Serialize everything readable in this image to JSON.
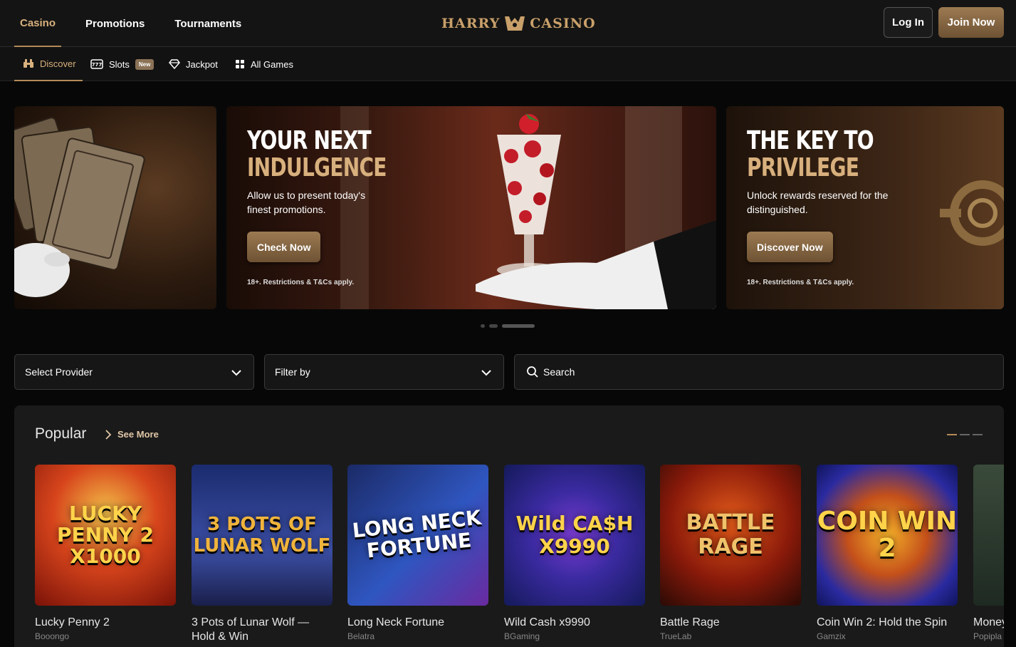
{
  "topnav": {
    "items": [
      "Casino",
      "Promotions",
      "Tournaments"
    ],
    "active": "Casino"
  },
  "logo": {
    "left": "HARRY",
    "right": "CASINO"
  },
  "auth": {
    "login": "Log In",
    "join": "Join Now"
  },
  "subnav": {
    "tabs": [
      {
        "label": "Discover",
        "icon": "binoculars-icon"
      },
      {
        "label": "Slots",
        "icon": "slot-machine-icon",
        "badge": "New"
      },
      {
        "label": "Jackpot",
        "icon": "diamond-icon"
      },
      {
        "label": "All Games",
        "icon": "grid-icon"
      }
    ]
  },
  "banners": [
    {
      "title1": "YOUR NEXT",
      "title2": "INDULGENCE",
      "desc": "Allow us to present today's finest promotions.",
      "cta": "Check Now",
      "terms": "18+. Restrictions & T&Cs apply."
    },
    {
      "title1": "THE KEY TO",
      "title2": "PRIVILEGE",
      "desc": "Unlock rewards reserved for the distinguished.",
      "cta": "Discover Now",
      "terms": "18+. Restrictions & T&Cs apply."
    }
  ],
  "filters": {
    "provider": "Select Provider",
    "filter": "Filter by",
    "search": "Search"
  },
  "popular": {
    "title": "Popular",
    "see_more": "See More",
    "games": [
      {
        "name": "Lucky Penny 2",
        "provider": "Booongo",
        "art": "LUCKY PENNY 2 X1000"
      },
      {
        "name": "3 Pots of Lunar Wolf — Hold & Win",
        "provider": "",
        "art": "3 POTS OF LUNAR WOLF"
      },
      {
        "name": "Long Neck Fortune",
        "provider": "Belatra",
        "art": "LONG NECK FORTUNE"
      },
      {
        "name": "Wild Cash x9990",
        "provider": "BGaming",
        "art": "Wild CA$H X9990"
      },
      {
        "name": "Battle Rage",
        "provider": "TrueLab",
        "art": "BATTLE RAGE"
      },
      {
        "name": "Coin Win 2: Hold the Spin",
        "provider": "Gamzix",
        "art": "COIN WIN 2"
      },
      {
        "name": "Money",
        "provider": "Popipla",
        "art": ""
      }
    ]
  }
}
